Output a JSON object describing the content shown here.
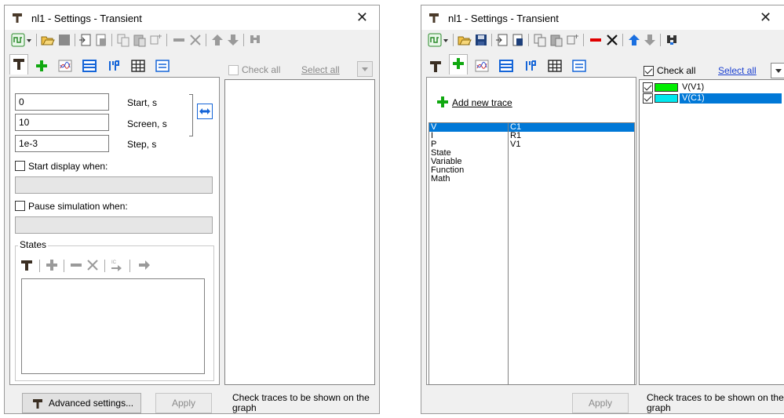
{
  "colors": {
    "trace_green": "#00ee00",
    "trace_cyan": "#00e8ee",
    "selection": "#0078d7",
    "plus_green": "#10a810",
    "delete_red": "#e00000",
    "arrow_blue": "#1a6fe0"
  },
  "window1": {
    "title": "nl1 - Settings - Transient",
    "check_all": "Check all",
    "select_all": "Select all",
    "fields": {
      "start": {
        "value": "0",
        "label": "Start, s"
      },
      "screen": {
        "value": "10",
        "label": "Screen, s"
      },
      "step": {
        "value": "1e-3",
        "label": "Step, s"
      }
    },
    "start_display_when": "Start display when:",
    "pause_simulation_when": "Pause simulation when:",
    "states_label": "States",
    "advanced_settings": "Advanced settings...",
    "apply": "Apply",
    "hint": [
      "Check traces to be shown on the",
      "graph"
    ]
  },
  "window2": {
    "title": "nl1 - Settings - Transient",
    "add_new_trace": "Add new trace",
    "categories": [
      "V",
      "I",
      "P",
      "State",
      "Variable",
      "Function",
      "Math"
    ],
    "selected_category": "V",
    "components": [
      "C1",
      "R1",
      "V1"
    ],
    "selected_component": "C1",
    "check_all": "Check all",
    "select_all": "Select all",
    "traces": [
      {
        "name": "V(V1)",
        "color": "#00ee00",
        "checked": true,
        "selected": false
      },
      {
        "name": "V(C1)",
        "color": "#00e8ee",
        "checked": true,
        "selected": true
      }
    ],
    "apply": "Apply",
    "hint": [
      "Check traces to be shown on the",
      "graph"
    ]
  }
}
